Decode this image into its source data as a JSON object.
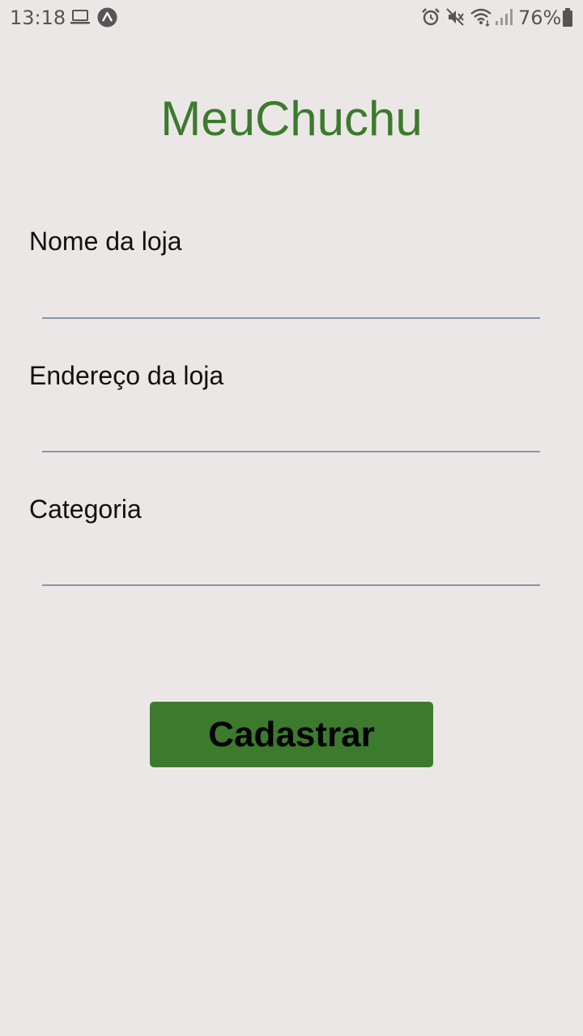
{
  "status_bar": {
    "time": "13:18",
    "battery": "76%",
    "icons": [
      "laptop-icon",
      "expo-icon",
      "alarm-icon",
      "mute-icon",
      "wifi-icon",
      "signal-icon",
      "battery-icon"
    ]
  },
  "app": {
    "title": "MeuChuchu",
    "accent_color": "#3c7a2d",
    "background_color": "#ece7e7"
  },
  "form": {
    "fields": [
      {
        "label": "Nome da loja",
        "value": "",
        "placeholder": ""
      },
      {
        "label": "Endereço da loja",
        "value": "",
        "placeholder": ""
      },
      {
        "label": "Categoria",
        "value": "",
        "placeholder": ""
      }
    ],
    "submit_label": "Cadastrar"
  }
}
